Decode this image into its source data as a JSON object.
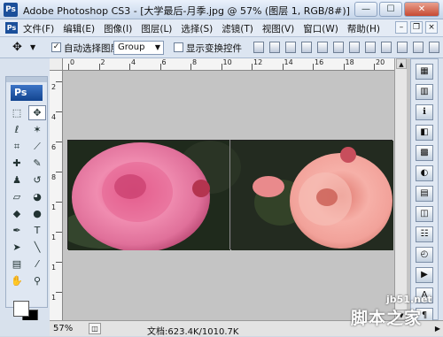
{
  "window": {
    "app_icon": "Ps",
    "title": "Adobe Photoshop CS3 - [大学最后-月季.jpg @ 57% (图层 1, RGB/8#)]",
    "buttons": {
      "minimize": "—",
      "maximize": "☐",
      "close": "✕"
    }
  },
  "menubar": {
    "app_icon": "Ps",
    "items": [
      "文件(F)",
      "编辑(E)",
      "图像(I)",
      "图层(L)",
      "选择(S)",
      "滤镜(T)",
      "视图(V)",
      "窗口(W)",
      "帮助(H)"
    ]
  },
  "options": {
    "auto_select_label": "自动选择图层",
    "auto_select_checked": true,
    "group_value": "Group",
    "show_transform_label": "显示变换控件",
    "show_transform_checked": false
  },
  "rulers": {
    "top": [
      "0",
      "2",
      "4",
      "6",
      "8",
      "10",
      "12",
      "14",
      "16",
      "18",
      "20"
    ],
    "left": [
      "2",
      "4",
      "6",
      "8",
      "1",
      "1",
      "1",
      "1"
    ]
  },
  "toolbox": {
    "badge": "Ps",
    "tools": [
      {
        "name": "marquee-tool",
        "glyph": "⬚"
      },
      {
        "name": "move-tool",
        "glyph": "✥"
      },
      {
        "name": "lasso-tool",
        "glyph": "ℓ"
      },
      {
        "name": "magic-wand-tool",
        "glyph": "✶"
      },
      {
        "name": "crop-tool",
        "glyph": "⌗"
      },
      {
        "name": "slice-tool",
        "glyph": "⟋"
      },
      {
        "name": "healing-brush-tool",
        "glyph": "✚"
      },
      {
        "name": "brush-tool",
        "glyph": "✎"
      },
      {
        "name": "clone-stamp-tool",
        "glyph": "♟"
      },
      {
        "name": "history-brush-tool",
        "glyph": "↺"
      },
      {
        "name": "eraser-tool",
        "glyph": "▱"
      },
      {
        "name": "paint-bucket-tool",
        "glyph": "◕"
      },
      {
        "name": "blur-tool",
        "glyph": "◆"
      },
      {
        "name": "dodge-tool",
        "glyph": "●"
      },
      {
        "name": "pen-tool",
        "glyph": "✒"
      },
      {
        "name": "type-tool",
        "glyph": "T"
      },
      {
        "name": "path-selection-tool",
        "glyph": "➤"
      },
      {
        "name": "line-tool",
        "glyph": "╲"
      },
      {
        "name": "notes-tool",
        "glyph": "▤"
      },
      {
        "name": "eyedropper-tool",
        "glyph": "⁄"
      },
      {
        "name": "hand-tool",
        "glyph": "✋"
      },
      {
        "name": "zoom-tool",
        "glyph": "⚲"
      }
    ]
  },
  "right_panel": {
    "icons": [
      "navigator-icon",
      "histogram-icon",
      "info-icon",
      "color-icon",
      "swatches-icon",
      "styles-icon",
      "layers-icon",
      "channels-icon",
      "paths-icon",
      "history-icon",
      "actions-icon",
      "character-icon",
      "paragraph-icon"
    ],
    "glyphs": [
      "▦",
      "▥",
      "ℹ",
      "◧",
      "▩",
      "◐",
      "▤",
      "◫",
      "☷",
      "◴",
      "▶",
      "A",
      "¶"
    ]
  },
  "status": {
    "zoom": "57%",
    "doc_info": "文档:623.4K/1010.7K"
  },
  "watermark": {
    "site": "jb51.net",
    "brand": "脚本之家"
  },
  "colors": {
    "accent": "#1b4f9a",
    "canvas_bg": "#c4c4c4",
    "ui_bg": "#dfe7f2"
  }
}
